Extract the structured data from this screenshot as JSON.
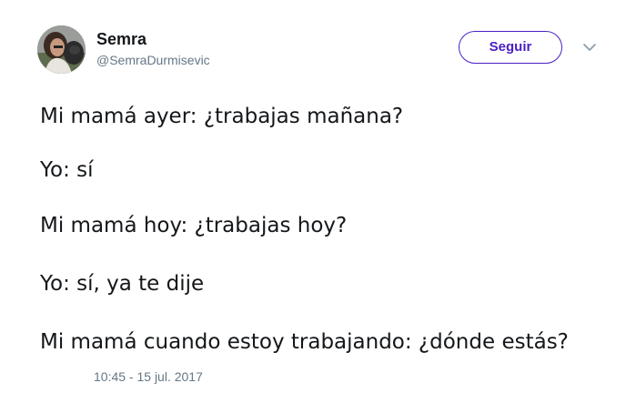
{
  "author": {
    "display_name": "Semra",
    "handle": "@SemraDurmisevic",
    "avatar_icon": "profile-photo"
  },
  "actions": {
    "follow_label": "Seguir",
    "menu_icon": "chevron-down-icon",
    "accent_color": "#4a1fc5"
  },
  "tweet": {
    "lines": [
      "Mi mamá ayer: ¿trabajas mañana?",
      "Yo: sí",
      "Mi mamá hoy: ¿trabajas hoy?",
      "Yo: sí, ya te dije",
      "Mi mamá cuando estoy trabajando: ¿dónde estás?"
    ],
    "timestamp": "10:45 - 15 jul. 2017"
  }
}
